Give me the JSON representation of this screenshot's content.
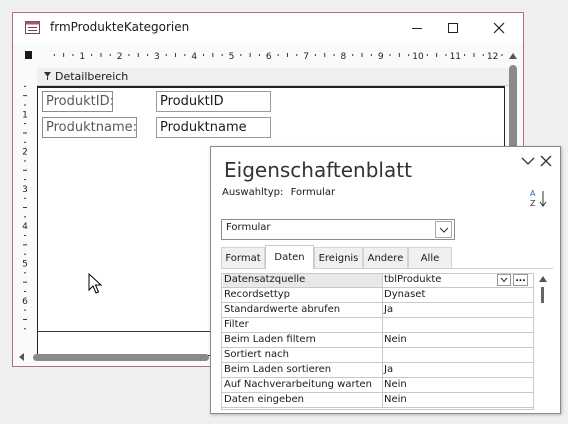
{
  "form_window": {
    "title": "frmProdukteKategorien",
    "title_icon": "form-icon",
    "controls": [
      "minimize",
      "maximize",
      "close"
    ],
    "detail_section_label": "Detailbereich",
    "h_ruler_numbers": [
      "1",
      "2",
      "3",
      "4",
      "5",
      "6",
      "7",
      "8",
      "9",
      "10",
      "11",
      "12"
    ],
    "v_ruler_numbers": [
      "1",
      "2",
      "3",
      "4",
      "5",
      "6"
    ],
    "labels": [
      {
        "text": "ProduktID:"
      },
      {
        "text": "Produktname:"
      }
    ],
    "textboxes": [
      {
        "text": "ProduktID"
      },
      {
        "text": "Produktname"
      }
    ]
  },
  "property_sheet": {
    "title": "Eigenschaftenblatt",
    "selection_type_label": "Auswahltyp:",
    "selection_type_value": "Formular",
    "object_selector": "Formular",
    "tabs": [
      {
        "label": "Format",
        "active": false
      },
      {
        "label": "Daten",
        "active": true
      },
      {
        "label": "Ereignis",
        "active": false
      },
      {
        "label": "Andere",
        "active": false
      },
      {
        "label": "Alle",
        "active": false
      }
    ],
    "rows": [
      {
        "name": "Datensatzquelle",
        "value": "tblProdukte"
      },
      {
        "name": "Recordsettyp",
        "value": "Dynaset"
      },
      {
        "name": "Standardwerte abrufen",
        "value": "Ja"
      },
      {
        "name": "Filter",
        "value": ""
      },
      {
        "name": "Beim Laden filtern",
        "value": "Nein"
      },
      {
        "name": "Sortiert nach",
        "value": ""
      },
      {
        "name": "Beim Laden sortieren",
        "value": "Ja"
      },
      {
        "name": "Auf Nachverarbeitung warten",
        "value": "Nein"
      },
      {
        "name": "Daten eingeben",
        "value": "Nein"
      }
    ],
    "build_button_label": "..."
  },
  "colors": {
    "window_border": "#b56a8c",
    "scrollbar_thumb": "#8a8a8a"
  }
}
